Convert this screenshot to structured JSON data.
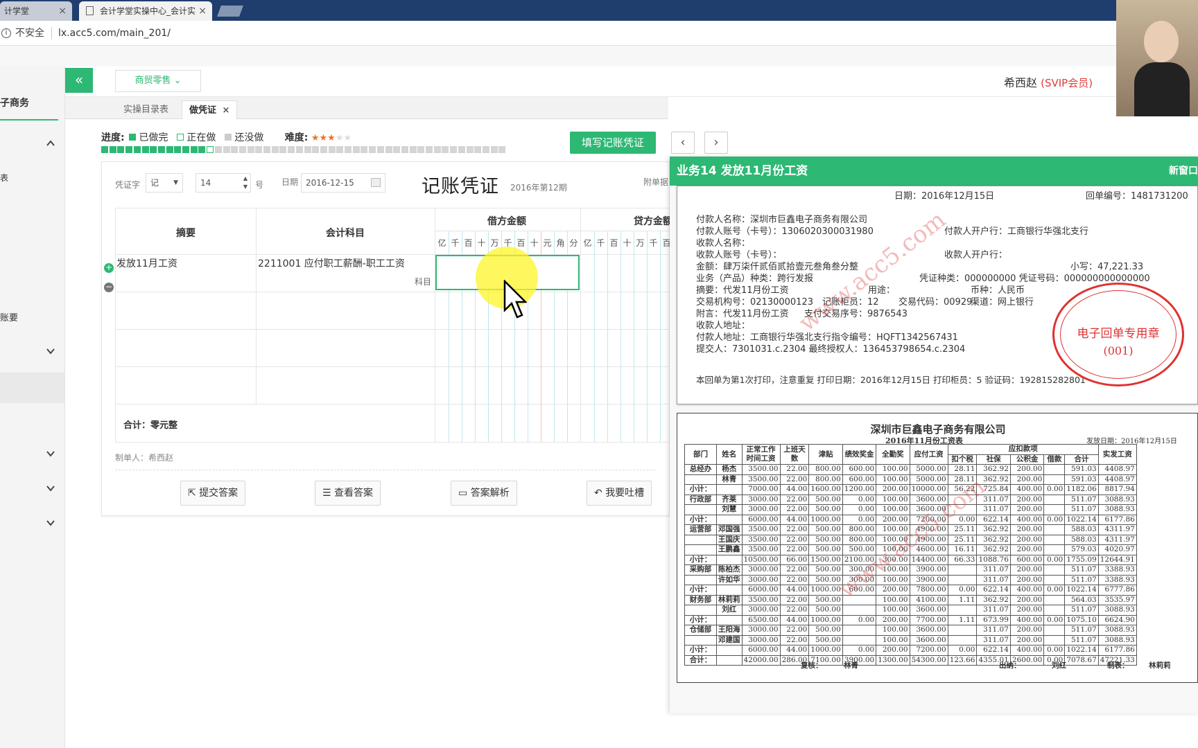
{
  "browser": {
    "tabs": [
      {
        "title": "计学堂"
      },
      {
        "title": "会计学堂实操中心_会计实"
      }
    ],
    "security_label": "不安全",
    "url": "lx.acc5.com/main_201/"
  },
  "header": {
    "collapse_symbol": "«",
    "dropdown_label": "商贸零售",
    "user_name": "希西赵",
    "vip_label": "(SVIP会员)"
  },
  "sidebar": {
    "title": "子商务",
    "items": [
      {
        "label": "表"
      },
      {
        "label": "账要"
      }
    ]
  },
  "subtabs": [
    {
      "label": "实操目录表"
    },
    {
      "label": "做凭证"
    }
  ],
  "progress": {
    "label": "进度:",
    "done": "已做完",
    "doing": "正在做",
    "todo": "还没做",
    "difficulty_label": "难度:",
    "difficulty_stars": 3,
    "difficulty_max": 5,
    "done_count": 13,
    "total_count": 50
  },
  "voucher": {
    "word_label": "凭证字",
    "word_value": "记",
    "number_value": "14",
    "number_suffix": "号",
    "date_label": "日期",
    "date_value": "2016-12-15",
    "title": "记账凭证",
    "period": "2016年第12期",
    "attach_label": "附单据",
    "col_summary": "摘要",
    "col_account": "会计科目",
    "col_debit": "借方金额",
    "col_credit": "贷方金额",
    "digits": [
      "亿",
      "千",
      "百",
      "十",
      "万",
      "千",
      "百",
      "十",
      "元",
      "角",
      "分"
    ],
    "row1_summary": "发放11月工资",
    "row1_account": "2211001 应付职工薪酬-职工工资",
    "row1_account_tag": "科目",
    "total": "合计：零元整",
    "maker": "制单人：希西赵"
  },
  "toolbar": {
    "fill_button": "填写记账凭证",
    "submit": "提交答案",
    "view_answer": "查看答案",
    "analysis": "答案解析",
    "feedback": "我要吐槽"
  },
  "panel": {
    "title": "业务14 发放11月份工资",
    "new_window": "新窗口"
  },
  "receipt": {
    "date": "日期：2016年12月15日",
    "receipt_no": "回单编号：1481731200",
    "payer_name": "付款人名称：深圳市巨鑫电子商务有限公司",
    "payer_account": "付款人账号（卡号）：1306020300031980",
    "payer_bank": "付款人开户行：工商银行华强北支行",
    "payee_name": "收款人名称：",
    "payee_account": "收款人账号（卡号）：",
    "payee_bank": "收款人开户行：",
    "amount_caps": "金额：肆万柒仟贰佰贰拾壹元叁角叁分整",
    "amount_small": "小写：47,221.33",
    "business_type": "业务（产品）种类：跨行发报",
    "voucher_type": "凭证种类：000000000 凭证号码：000000000000000",
    "memo": "摘要：代发11月份工资",
    "usage": "用途：",
    "currency": "币种：人民币",
    "txn_org": "交易机构号：02130000123",
    "counter": "记账柜员：12",
    "txn_code": "交易代码：00929",
    "channel": "渠道：网上银行",
    "postscript": "附言：代发11月份工资",
    "pay_seq": "支付交易序号：9876543",
    "payee_addr": "收款人地址：",
    "payer_addr": "付款人地址：工商银行华强北支行指令编号：HQFT1342567431",
    "submitter": "提交人：7301031.c.2304 最终授权人：136453798654.c.2304",
    "footer": "本回单为第1次打印，注意重复  打印日期：2016年12月15日  打印柜员：5  验证码：192815282801",
    "stamp_text": "电子回单专用章",
    "stamp_num": "(001)",
    "watermark": "www.acc5.com"
  },
  "payroll": {
    "company": "深圳市巨鑫电子商务有限公司",
    "subtitle": "2016年11月份工资表",
    "pay_date": "发放日期：2016年12月15日",
    "headers": [
      "部门",
      "姓名",
      "正常工作时间工资",
      "上班天数",
      "津贴",
      "绩效奖金",
      "全勤奖",
      "应付工资",
      "扣个税",
      "社保",
      "公积金",
      "借款",
      "合计",
      "实发工资"
    ],
    "deduct_header": "应扣款项",
    "rows": [
      [
        "总经办",
        "杨杰",
        "3500.00",
        "22.00",
        "800.00",
        "600.00",
        "100.00",
        "5000.00",
        "28.11",
        "362.92",
        "200.00",
        "",
        "591.03",
        "4408.97"
      ],
      [
        "",
        "林青",
        "3500.00",
        "22.00",
        "800.00",
        "600.00",
        "100.00",
        "5000.00",
        "28.11",
        "362.92",
        "200.00",
        "",
        "591.03",
        "4408.97"
      ],
      [
        "小计：",
        "",
        "7000.00",
        "44.00",
        "1600.00",
        "1200.00",
        "200.00",
        "10000.00",
        "56.22",
        "725.84",
        "400.00",
        "0.00",
        "1182.06",
        "8817.94"
      ],
      [
        "行政部",
        "齐莱",
        "3000.00",
        "22.00",
        "500.00",
        "0.00",
        "100.00",
        "3600.00",
        "",
        "311.07",
        "200.00",
        "",
        "511.07",
        "3088.93"
      ],
      [
        "",
        "刘慧",
        "3000.00",
        "22.00",
        "500.00",
        "0.00",
        "100.00",
        "3600.00",
        "",
        "311.07",
        "200.00",
        "",
        "511.07",
        "3088.93"
      ],
      [
        "小计：",
        "",
        "6000.00",
        "44.00",
        "1000.00",
        "0.00",
        "200.00",
        "7200.00",
        "0.00",
        "622.14",
        "400.00",
        "0.00",
        "1022.14",
        "6177.86"
      ],
      [
        "运营部",
        "邓国强",
        "3500.00",
        "22.00",
        "500.00",
        "800.00",
        "100.00",
        "4900.00",
        "25.11",
        "362.92",
        "200.00",
        "",
        "588.03",
        "4311.97"
      ],
      [
        "",
        "王国庆",
        "3500.00",
        "22.00",
        "500.00",
        "800.00",
        "100.00",
        "4900.00",
        "25.11",
        "362.92",
        "200.00",
        "",
        "588.03",
        "4311.97"
      ],
      [
        "",
        "王鹏鑫",
        "3500.00",
        "22.00",
        "500.00",
        "500.00",
        "100.00",
        "4600.00",
        "16.11",
        "362.92",
        "200.00",
        "",
        "579.03",
        "4020.97"
      ],
      [
        "小计：",
        "",
        "10500.00",
        "66.00",
        "1500.00",
        "2100.00",
        "300.00",
        "14400.00",
        "66.33",
        "1088.76",
        "600.00",
        "0.00",
        "1755.09",
        "12644.91"
      ],
      [
        "采购部",
        "陈柏杰",
        "3000.00",
        "22.00",
        "500.00",
        "300.00",
        "100.00",
        "3900.00",
        "",
        "311.07",
        "200.00",
        "",
        "511.07",
        "3388.93"
      ],
      [
        "",
        "许如华",
        "3000.00",
        "22.00",
        "500.00",
        "300.00",
        "100.00",
        "3900.00",
        "",
        "311.07",
        "200.00",
        "",
        "511.07",
        "3388.93"
      ],
      [
        "小计：",
        "",
        "6000.00",
        "44.00",
        "1000.00",
        "600.00",
        "200.00",
        "7800.00",
        "0.00",
        "622.14",
        "400.00",
        "0.00",
        "1022.14",
        "6777.86"
      ],
      [
        "财务部",
        "林莉莉",
        "3500.00",
        "22.00",
        "500.00",
        "",
        "100.00",
        "4100.00",
        "1.11",
        "362.92",
        "200.00",
        "",
        "564.03",
        "3535.97"
      ],
      [
        "",
        "刘红",
        "3000.00",
        "22.00",
        "500.00",
        "",
        "100.00",
        "3600.00",
        "",
        "311.07",
        "200.00",
        "",
        "511.07",
        "3088.93"
      ],
      [
        "小计：",
        "",
        "6500.00",
        "44.00",
        "1000.00",
        "0.00",
        "200.00",
        "7700.00",
        "1.11",
        "673.99",
        "400.00",
        "0.00",
        "1075.10",
        "6624.90"
      ],
      [
        "仓储部",
        "王阳海",
        "3000.00",
        "22.00",
        "500.00",
        "",
        "100.00",
        "3600.00",
        "",
        "311.07",
        "200.00",
        "",
        "511.07",
        "3088.93"
      ],
      [
        "",
        "邓建国",
        "3000.00",
        "22.00",
        "500.00",
        "",
        "100.00",
        "3600.00",
        "",
        "311.07",
        "200.00",
        "",
        "511.07",
        "3088.93"
      ],
      [
        "小计：",
        "",
        "6000.00",
        "44.00",
        "1000.00",
        "0.00",
        "200.00",
        "7200.00",
        "0.00",
        "622.14",
        "400.00",
        "0.00",
        "1022.14",
        "6177.86"
      ],
      [
        "合计：",
        "",
        "42000.00",
        "286.00",
        "7100.00",
        "3900.00",
        "1300.00",
        "54300.00",
        "123.66",
        "4355.01",
        "2600.00",
        "0.00",
        "7078.67",
        "47221.33"
      ]
    ],
    "sign_review": "复核：",
    "sign_review_name": "林青",
    "sign_cashier": "出纳：",
    "sign_cashier_name": "刘红",
    "sign_maker": "制表：",
    "sign_maker_name": "林莉莉"
  },
  "colors": {
    "accent": "#2db873",
    "vip": "#e23b3b",
    "stamp": "#d33333"
  }
}
